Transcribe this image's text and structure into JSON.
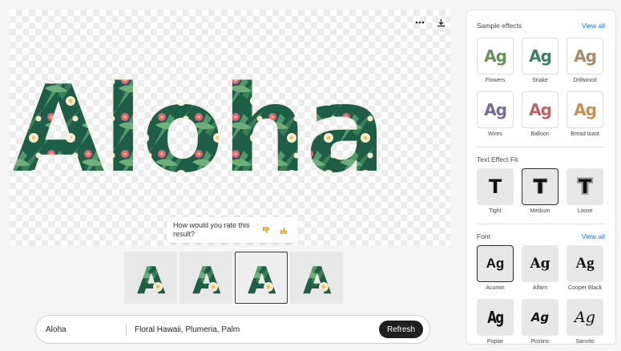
{
  "canvas": {
    "more_icon": "ellipsis-icon",
    "download_icon": "download-icon",
    "hero_text": "Aloha"
  },
  "rating": {
    "question": "How would you rate this result?",
    "thumbs_down_icon": "thumbs-down-icon",
    "thumbs_up_icon": "thumbs-up-icon"
  },
  "variations": [
    {
      "letter": "A",
      "selected": false
    },
    {
      "letter": "A",
      "selected": false
    },
    {
      "letter": "A",
      "selected": true
    },
    {
      "letter": "A",
      "selected": false
    }
  ],
  "prompt": {
    "text": "Aloha",
    "style": "Floral Hawaii, Plumeria, Palm",
    "refresh_label": "Refresh"
  },
  "sample_effects": {
    "title": "Sample effects",
    "view_all": "View all",
    "preview_text": "Ag",
    "items": [
      {
        "label": "Flowers",
        "color": "#6b8f5a"
      },
      {
        "label": "Snake",
        "color": "#3f7f6a"
      },
      {
        "label": "Driftwood",
        "color": "#a68a6a"
      },
      {
        "label": "Wires",
        "color": "#7a6a9a"
      },
      {
        "label": "Balloon",
        "color": "#c4606a"
      },
      {
        "label": "Bread toast",
        "color": "#c98e50"
      }
    ]
  },
  "text_effect_fit": {
    "title": "Text Effect Fit",
    "glyph": "T",
    "items": [
      {
        "label": "Tight",
        "selected": false
      },
      {
        "label": "Medium",
        "selected": true
      },
      {
        "label": "Loose",
        "selected": false
      }
    ]
  },
  "font": {
    "title": "Font",
    "view_all": "View all",
    "preview_text": "Ag",
    "items": [
      {
        "label": "Acumin",
        "selected": true
      },
      {
        "label": "Alfarn",
        "selected": false
      },
      {
        "label": "Cooper Black",
        "selected": false
      },
      {
        "label": "Poplar",
        "selected": false
      },
      {
        "label": "Postino",
        "selected": false
      },
      {
        "label": "Sanvito",
        "selected": false
      }
    ]
  },
  "colors": {
    "leaf_dark": "#1f5e46",
    "leaf_light": "#4e9a6a",
    "flower_pink": "#e0608a",
    "flower_cream": "#f6ecd0",
    "flower_yellow": "#f2c14a",
    "accent_blue": "#1473e6"
  }
}
